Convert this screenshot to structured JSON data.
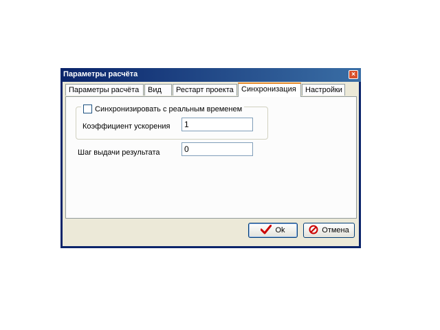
{
  "window": {
    "title": "Параметры расчёта",
    "close_glyph": "×"
  },
  "tabs": [
    {
      "label": "Параметры расчёта",
      "active": false
    },
    {
      "label": "Вид",
      "active": false
    },
    {
      "label": "Рестарт проекта",
      "active": false
    },
    {
      "label": "Синхронизация",
      "active": true
    },
    {
      "label": "Настройки",
      "active": false
    }
  ],
  "sync": {
    "checkbox_label": "Синхронизировать с реальным временем",
    "checkbox_checked": false,
    "accel_label": "Коэффициент ускорения",
    "accel_value": "1",
    "step_label": "Шаг выдачи результата",
    "step_value": "0"
  },
  "buttons": {
    "ok_label": "Ok",
    "cancel_label": "Отмена"
  },
  "colors": {
    "titlebar": "#0a246a",
    "ok_icon": "#cc0000",
    "cancel_icon": "#cc0000"
  },
  "icons": {
    "ok": "checkmark-icon",
    "cancel": "no-entry-icon",
    "close": "close-icon"
  }
}
